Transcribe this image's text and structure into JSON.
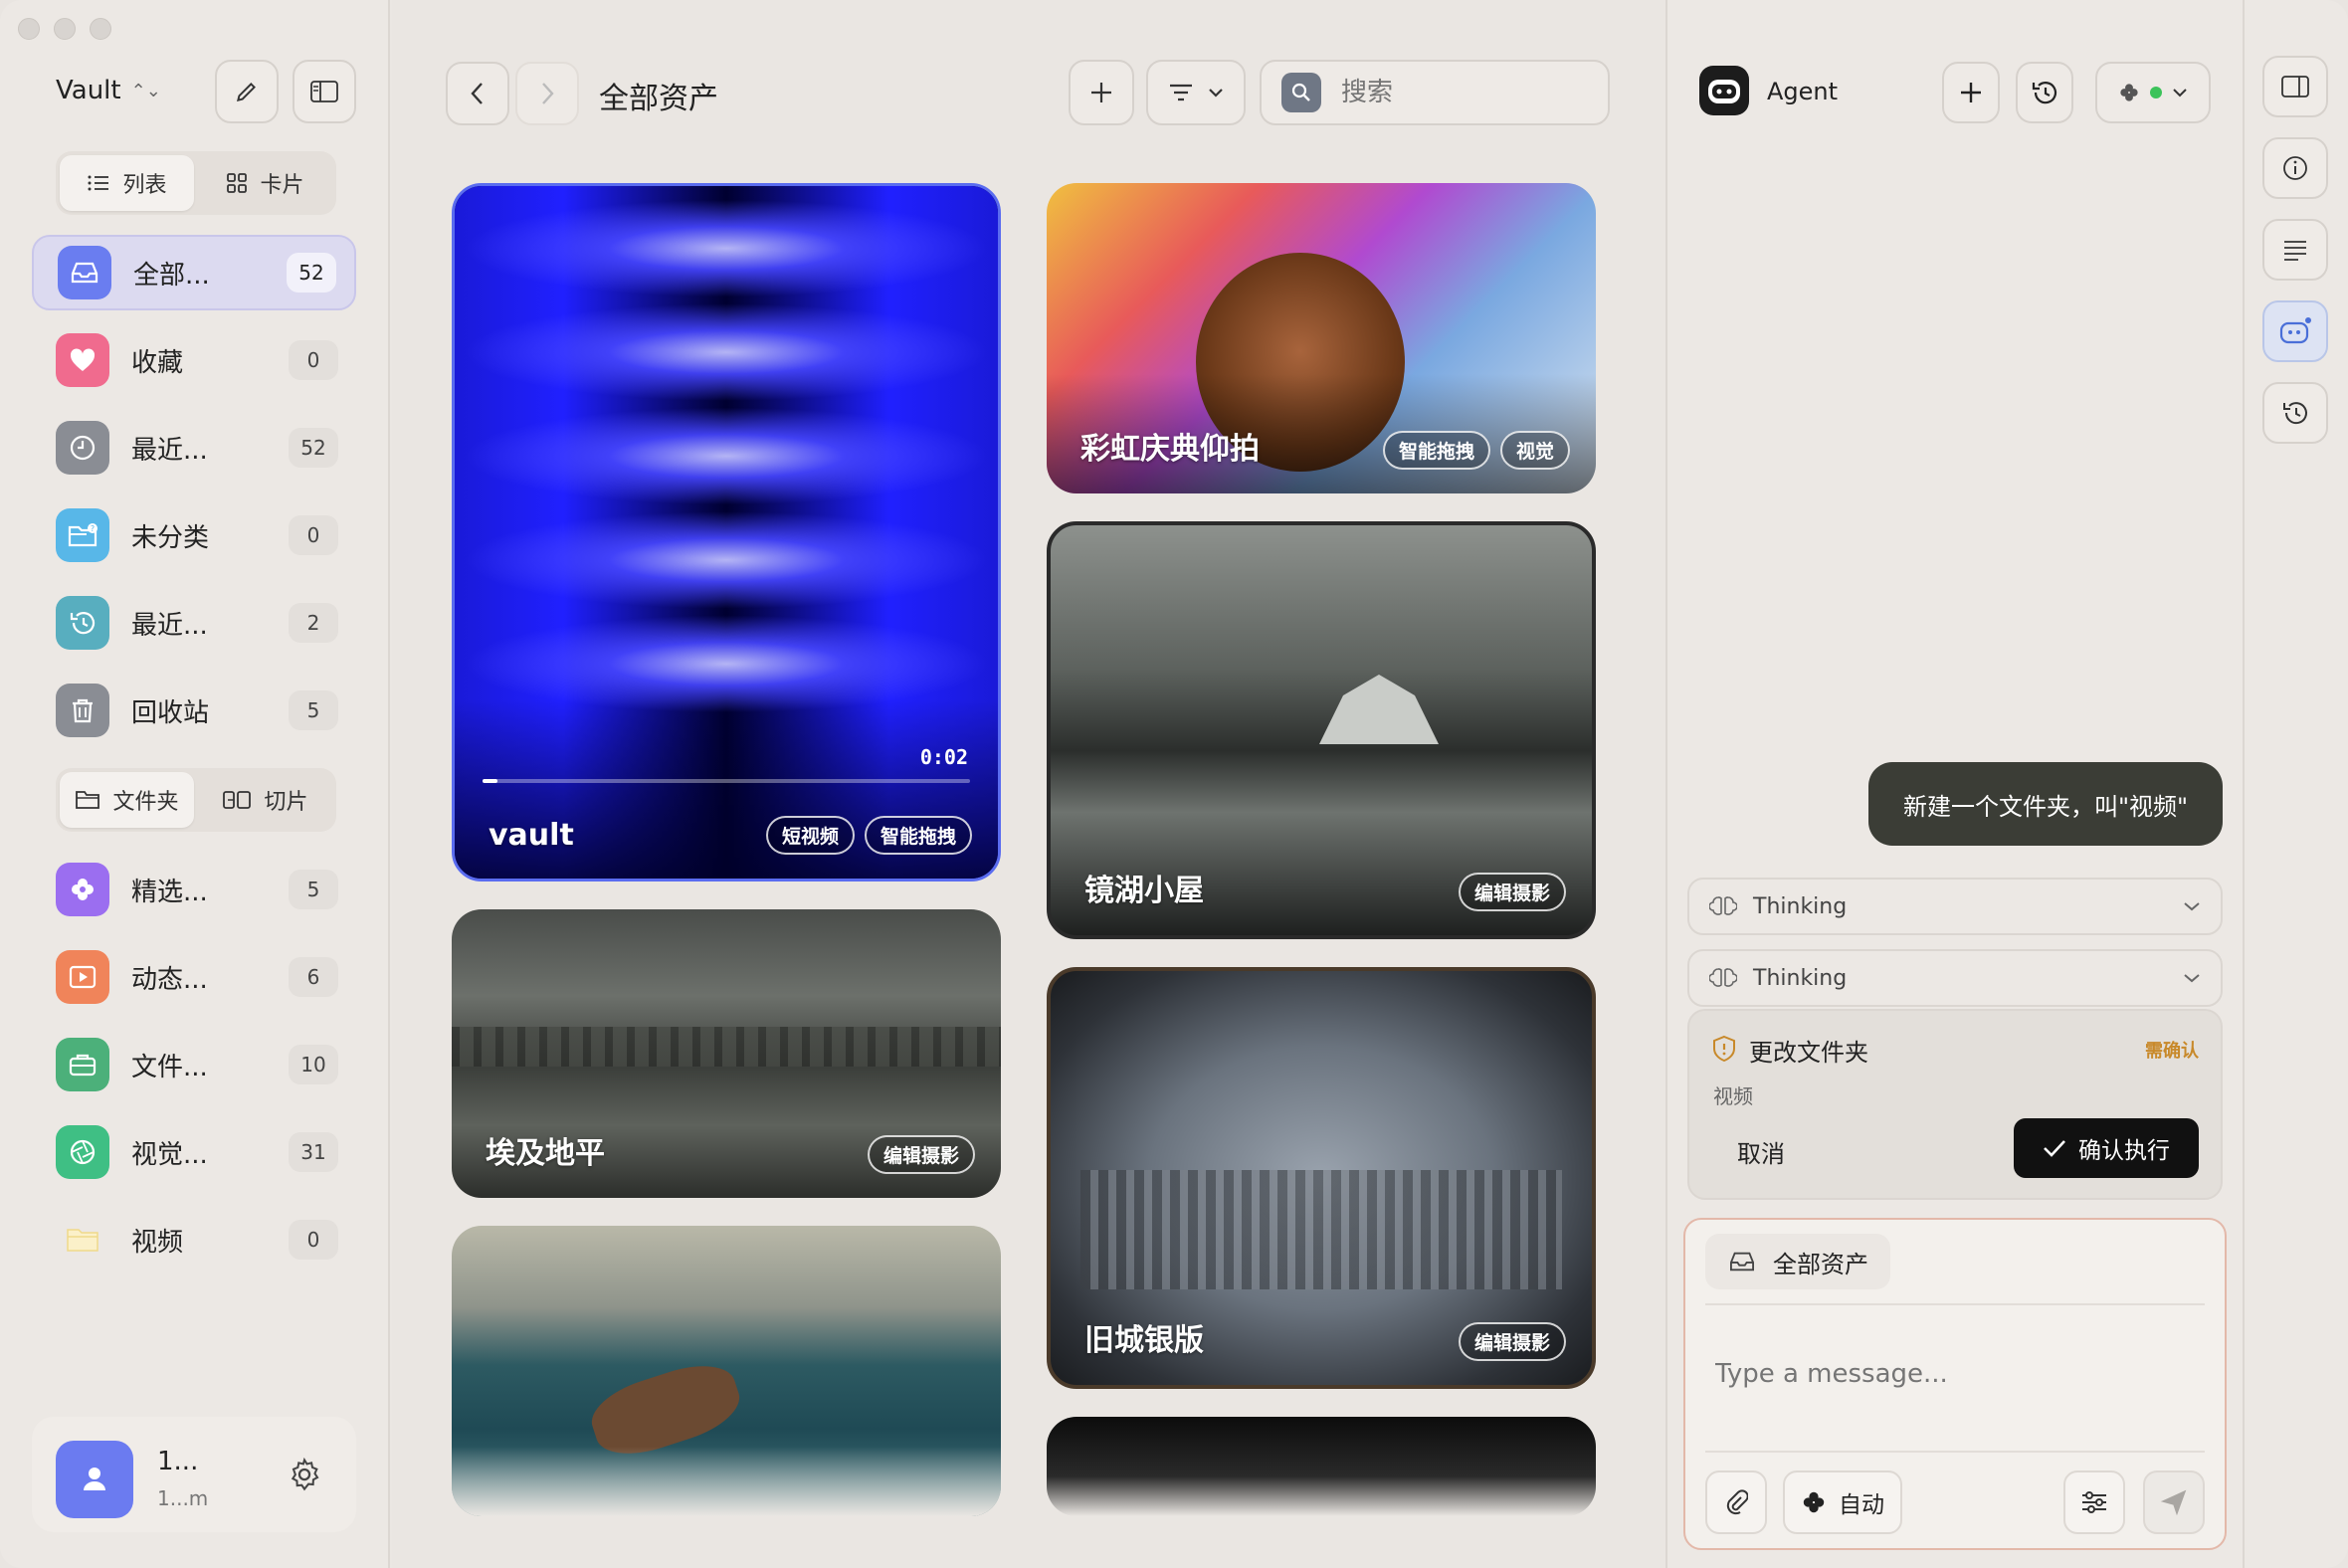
{
  "sidebar": {
    "vault_title": "Vault",
    "view_toggle": {
      "list": "列表",
      "card": "卡片"
    },
    "items": [
      {
        "label": "全部...",
        "count": "52",
        "color": "#6a7df0",
        "icon": "inbox-icon",
        "active": true
      },
      {
        "label": "收藏",
        "count": "0",
        "color": "#f06b8e",
        "icon": "heart-icon"
      },
      {
        "label": "最近...",
        "count": "52",
        "color": "#8a8d94",
        "icon": "clock-icon"
      },
      {
        "label": "未分类",
        "count": "0",
        "color": "#58b7e8",
        "icon": "folder-question-icon"
      },
      {
        "label": "最近...",
        "count": "2",
        "color": "#58aebf",
        "icon": "history-icon"
      },
      {
        "label": "回收站",
        "count": "5",
        "color": "#8a8d94",
        "icon": "trash-icon"
      }
    ],
    "folder_toggle": {
      "folders": "文件夹",
      "slices": "切片"
    },
    "folders": [
      {
        "label": "精选...",
        "count": "5",
        "color": "#9b6ef0",
        "icon": "flower-icon"
      },
      {
        "label": "动态...",
        "count": "6",
        "color": "#f0845a",
        "icon": "play-icon"
      },
      {
        "label": "文件...",
        "count": "10",
        "color": "#4cb07a",
        "icon": "briefcase-icon"
      },
      {
        "label": "视觉...",
        "count": "31",
        "color": "#3fbf84",
        "icon": "aperture-icon"
      },
      {
        "label": "视频",
        "count": "0",
        "color": "#f5e3a8",
        "icon": "folder-icon"
      }
    ],
    "user": {
      "name": "1...",
      "sub": "1...m"
    }
  },
  "main": {
    "title": "全部资产",
    "search_placeholder": "搜索",
    "cards": [
      {
        "title": "vault",
        "tags": [
          "短视频",
          "智能拖拽"
        ],
        "duration": "0:02",
        "progress": 0.03
      },
      {
        "title": "彩虹庆典仰拍",
        "tags": [
          "智能拖拽",
          "视觉"
        ]
      },
      {
        "title": "镜湖小屋",
        "tags": [
          "编辑摄影"
        ]
      },
      {
        "title": "埃及地平",
        "tags": [
          "编辑摄影"
        ]
      },
      {
        "title": "旧城银版",
        "tags": [
          "编辑摄影"
        ]
      }
    ]
  },
  "agent": {
    "name": "Agent",
    "user_message": "新建一个文件夹，叫\"视频\"",
    "thinking": [
      "Thinking",
      "Thinking"
    ],
    "confirm": {
      "title": "更改文件夹",
      "badge": "需确认",
      "sub": "视频",
      "cancel": "取消",
      "ok": "确认执行"
    },
    "composer": {
      "context": "全部资产",
      "placeholder": "Type a message...",
      "mode": "自动"
    }
  },
  "colors": {
    "accent": "#6a7df0",
    "dark": "#111111",
    "warn": "#c8892a",
    "status_green": "#3cc35a"
  }
}
